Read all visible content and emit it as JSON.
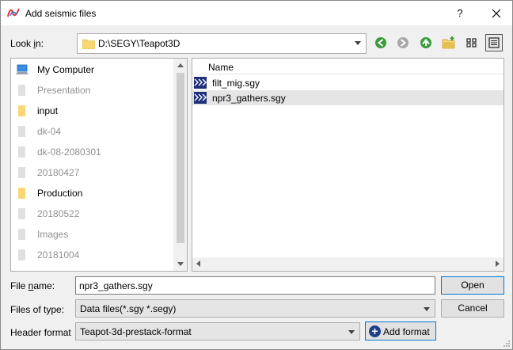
{
  "window": {
    "title": "Add seismic files",
    "help_glyph": "?",
    "close_glyph": "✕"
  },
  "lookin": {
    "label_prefix": "Look ",
    "label_mnemonic": "i",
    "label_suffix": "n:",
    "path": "D:\\SEGY\\Teapot3D"
  },
  "toolbar": {
    "icons": [
      "back-icon",
      "forward-icon",
      "up-folder-icon",
      "new-folder-icon",
      "list-view-icon",
      "detail-view-icon"
    ]
  },
  "sidebar": {
    "items": [
      {
        "label": "My Computer",
        "icon": "computer-icon",
        "dim": false
      },
      {
        "label": "Presentation",
        "icon": "folder-icon",
        "dim": true
      },
      {
        "label": "input",
        "icon": "folder-icon",
        "dim": false
      },
      {
        "label": "dk-04",
        "icon": "folder-icon",
        "dim": true
      },
      {
        "label": "dk-08-2080301",
        "icon": "folder-icon",
        "dim": true
      },
      {
        "label": "20180427",
        "icon": "folder-icon",
        "dim": true
      },
      {
        "label": "Production",
        "icon": "folder-icon",
        "dim": false
      },
      {
        "label": "20180522",
        "icon": "folder-icon",
        "dim": true
      },
      {
        "label": "Images",
        "icon": "folder-icon",
        "dim": true
      },
      {
        "label": "20181004",
        "icon": "folder-icon",
        "dim": true
      }
    ]
  },
  "filelist": {
    "column_name": "Name",
    "files": [
      {
        "name": "filt_mig.sgy",
        "selected": false
      },
      {
        "name": "npr3_gathers.sgy",
        "selected": true
      }
    ]
  },
  "form": {
    "filename_label_prefix": "File ",
    "filename_label_mnemonic": "n",
    "filename_label_suffix": "ame:",
    "filename_value": "npr3_gathers.sgy",
    "filetype_label": "Files of type:",
    "filetype_value": "Data files(*.sgy *.segy)",
    "header_label": "Header format",
    "header_value": "Teapot-3d-prestack-format",
    "open_label": "Open",
    "cancel_label": "Cancel",
    "add_format_label": "Add format"
  },
  "colors": {
    "accent": "#0078d7",
    "folder": "#f8d775",
    "nav_green": "#3c9a3c"
  }
}
